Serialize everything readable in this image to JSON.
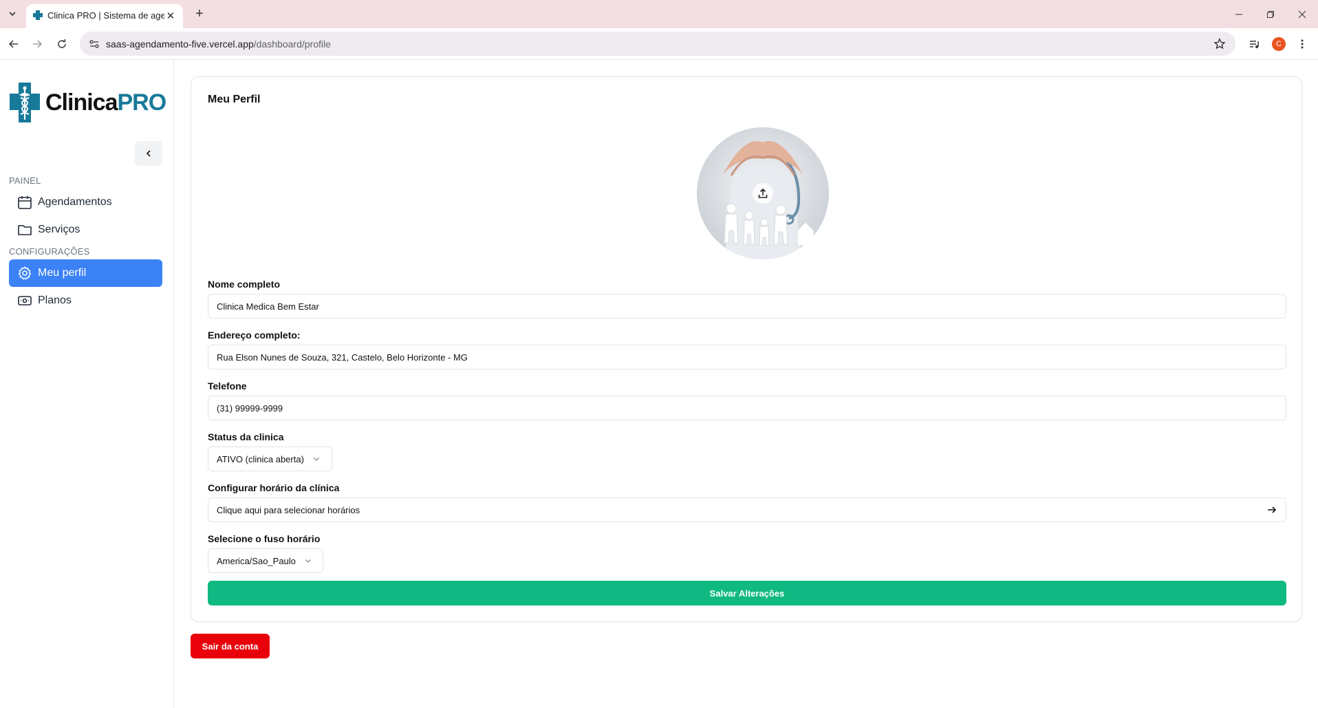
{
  "browser": {
    "tab_title": "Clinica PRO | Sistema de agendamento",
    "url_host": "saas-agendamento-five.vercel.app",
    "url_path": "/dashboard/profile",
    "profile_initial": "C"
  },
  "sidebar": {
    "logo_primary": "Clinica",
    "logo_accent": "PRO",
    "sections": [
      {
        "label": "PAINEL",
        "items": [
          {
            "label": "Agendamentos",
            "icon": "calendar-icon"
          },
          {
            "label": "Serviços",
            "icon": "folder-icon"
          }
        ]
      },
      {
        "label": "CONFIGURAÇÕES",
        "items": [
          {
            "label": "Meu perfil",
            "icon": "gear-icon",
            "active": true
          },
          {
            "label": "Planos",
            "icon": "banknote-icon"
          }
        ]
      }
    ]
  },
  "profile": {
    "title": "Meu Perfil",
    "fields": {
      "name_label": "Nome completo",
      "name_value": "Clinica Medica Bem Estar",
      "address_label": "Endereço completo:",
      "address_value": "Rua Elson Nunes de Souza, 321, Castelo, Belo Horizonte - MG",
      "phone_label": "Telefone",
      "phone_value": "(31) 99999-9999",
      "status_label": "Status da clinica",
      "status_value": "ATIVO (clinica aberta)",
      "hours_label": "Configurar horário da clínica",
      "hours_value": "Clique aqui para selecionar horários",
      "timezone_label": "Selecione o fuso horário",
      "timezone_value": "America/Sao_Paulo"
    },
    "save_label": "Salvar Alterações",
    "logout_label": "Sair da conta"
  },
  "colors": {
    "active_nav": "#3b82f6",
    "save_button": "#10b981",
    "logout_button": "#e8000b",
    "logo_accent": "#187a9a"
  }
}
